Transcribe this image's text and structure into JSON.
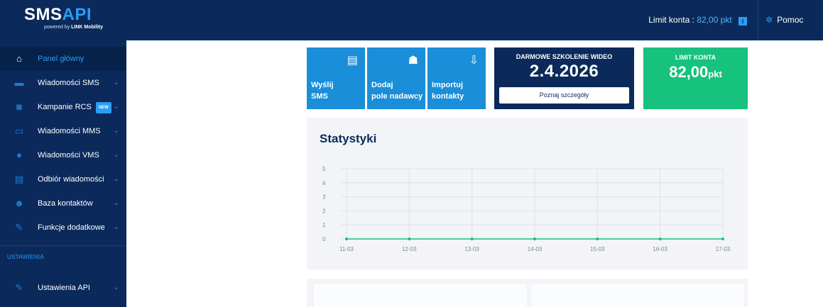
{
  "brand": {
    "name_part1": "SMS",
    "name_part2": "API",
    "tagline_prefix": "powered by ",
    "tagline_brand": "LINK Mobility"
  },
  "header": {
    "limit_label": "Limit konta :",
    "limit_value": "82,00 pkt",
    "limit_icon": "info-icon",
    "help_label": "Pomoc",
    "help_icon": "gear-icon"
  },
  "sidebar": {
    "items": [
      {
        "label": "Panel główny",
        "icon": "home-icon",
        "active": true
      },
      {
        "label": "Wiadomości SMS",
        "icon": "message-icon"
      },
      {
        "label": "Kampanie RCS",
        "icon": "chat-icon",
        "badge": "NEW"
      },
      {
        "label": "Wiadomości MMS",
        "icon": "image-icon"
      },
      {
        "label": "Wiadomości VMS",
        "icon": "microphone-icon"
      },
      {
        "label": "Odbiór wiadomości",
        "icon": "inbox-icon"
      },
      {
        "label": "Baza kontaktów",
        "icon": "contacts-icon"
      },
      {
        "label": "Funkcje dodatkowe",
        "icon": "wrench-icon"
      }
    ],
    "section_title": "USTAWIENIA",
    "settings_items": [
      {
        "label": "Ustawienia API",
        "icon": "wrench-icon"
      }
    ]
  },
  "tiles": {
    "send_sms": {
      "line1": "Wyślij",
      "line2": "SMS"
    },
    "add_sender": {
      "line1": "Dodaj",
      "line2": "pole nadawcy"
    },
    "import_contacts": {
      "line1": "Importuj",
      "line2": "kontakty"
    }
  },
  "promo": {
    "title": "DARMOWE SZKOLENIE WIDEO",
    "date": "2.4.2026",
    "button": "Poznaj szczegóły"
  },
  "limit_box": {
    "title": "LIMIT KONTA",
    "value": "82,00",
    "unit": "pkt"
  },
  "stats": {
    "title": "Statystyki"
  },
  "colors": {
    "navy": "#0b2a5b",
    "accent": "#2a9df4",
    "tile_blue": "#1a8ed8",
    "green": "#17c17e"
  },
  "chart_data": {
    "type": "line",
    "categories": [
      "11-03",
      "12-03",
      "13-03",
      "14-03",
      "15-03",
      "16-03",
      "17-03"
    ],
    "series": [
      {
        "values": [
          0,
          0,
          0,
          0,
          0,
          0,
          0
        ],
        "color": "#17c17e"
      }
    ],
    "ylim": [
      0,
      5
    ],
    "yticks": [
      0,
      1,
      2,
      3,
      4,
      5
    ],
    "grid": true
  }
}
